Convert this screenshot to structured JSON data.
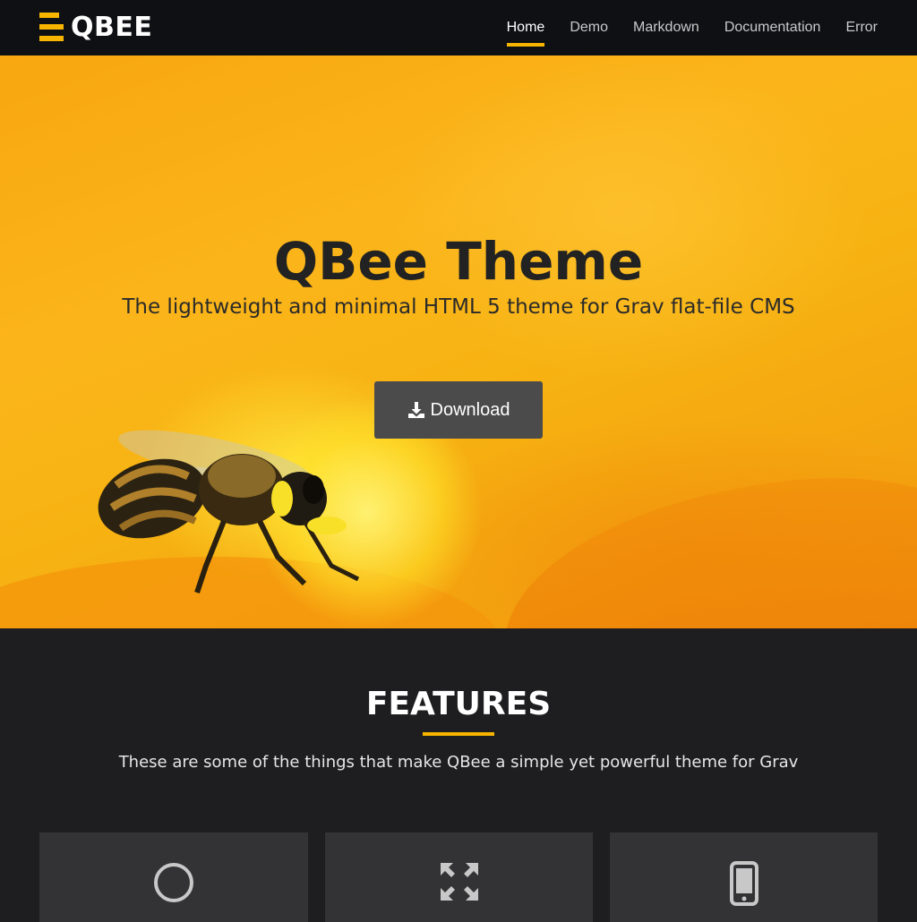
{
  "brand": {
    "name": "QBEE",
    "accent": "#f7b500"
  },
  "nav": {
    "items": [
      {
        "label": "Home",
        "active": true
      },
      {
        "label": "Demo",
        "active": false
      },
      {
        "label": "Markdown",
        "active": false
      },
      {
        "label": "Documentation",
        "active": false
      },
      {
        "label": "Error",
        "active": false
      }
    ]
  },
  "hero": {
    "title": "QBee Theme",
    "subtitle": "The lightweight and minimal HTML 5 theme for Grav flat-file CMS",
    "button_label": "Download",
    "button_icon": "download-icon"
  },
  "features": {
    "title": "FEATURES",
    "text": "These are some of the things that make QBee a simple yet powerful theme for Grav",
    "cards": [
      {
        "icon": "circle-icon"
      },
      {
        "icon": "expand-arrows-icon"
      },
      {
        "icon": "mobile-phone-icon"
      }
    ]
  }
}
